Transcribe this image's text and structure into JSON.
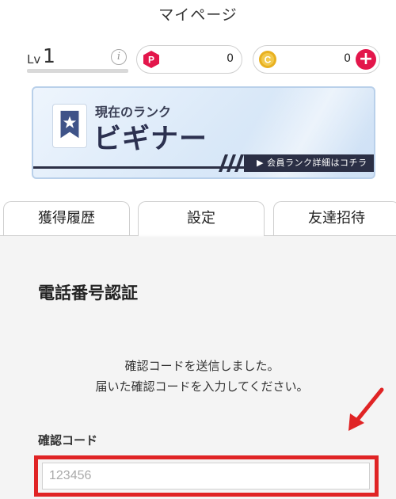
{
  "page": {
    "title": "マイページ"
  },
  "level": {
    "prefix": "Lv",
    "value": "1",
    "info_icon": "info-icon"
  },
  "wallet": {
    "points": {
      "value": "0",
      "badge_letter": "P",
      "badge_color": "#e3164b"
    },
    "coins": {
      "value": "0",
      "badge_letter": "C",
      "badge_color": "#e0a81a",
      "add_icon": "plus-icon"
    }
  },
  "rank": {
    "label": "現在のランク",
    "name": "ビギナー",
    "detail_link": "▶ 会員ランク詳細はコチラ",
    "icon": "rank-ribbon-icon"
  },
  "tabs": [
    {
      "label": "獲得履歴",
      "active": false
    },
    {
      "label": "設定",
      "active": true
    },
    {
      "label": "友達招待",
      "active": false
    }
  ],
  "verification": {
    "title": "電話番号認証",
    "message_line1": "確認コードを送信しました。",
    "message_line2": "届いた確認コードを入力してください。",
    "code_label": "確認コード",
    "code_placeholder": "123456",
    "code_value": ""
  },
  "colors": {
    "accent_red": "#e02425",
    "plus_red": "#e3164b",
    "rank_dark": "#2b2f45"
  }
}
